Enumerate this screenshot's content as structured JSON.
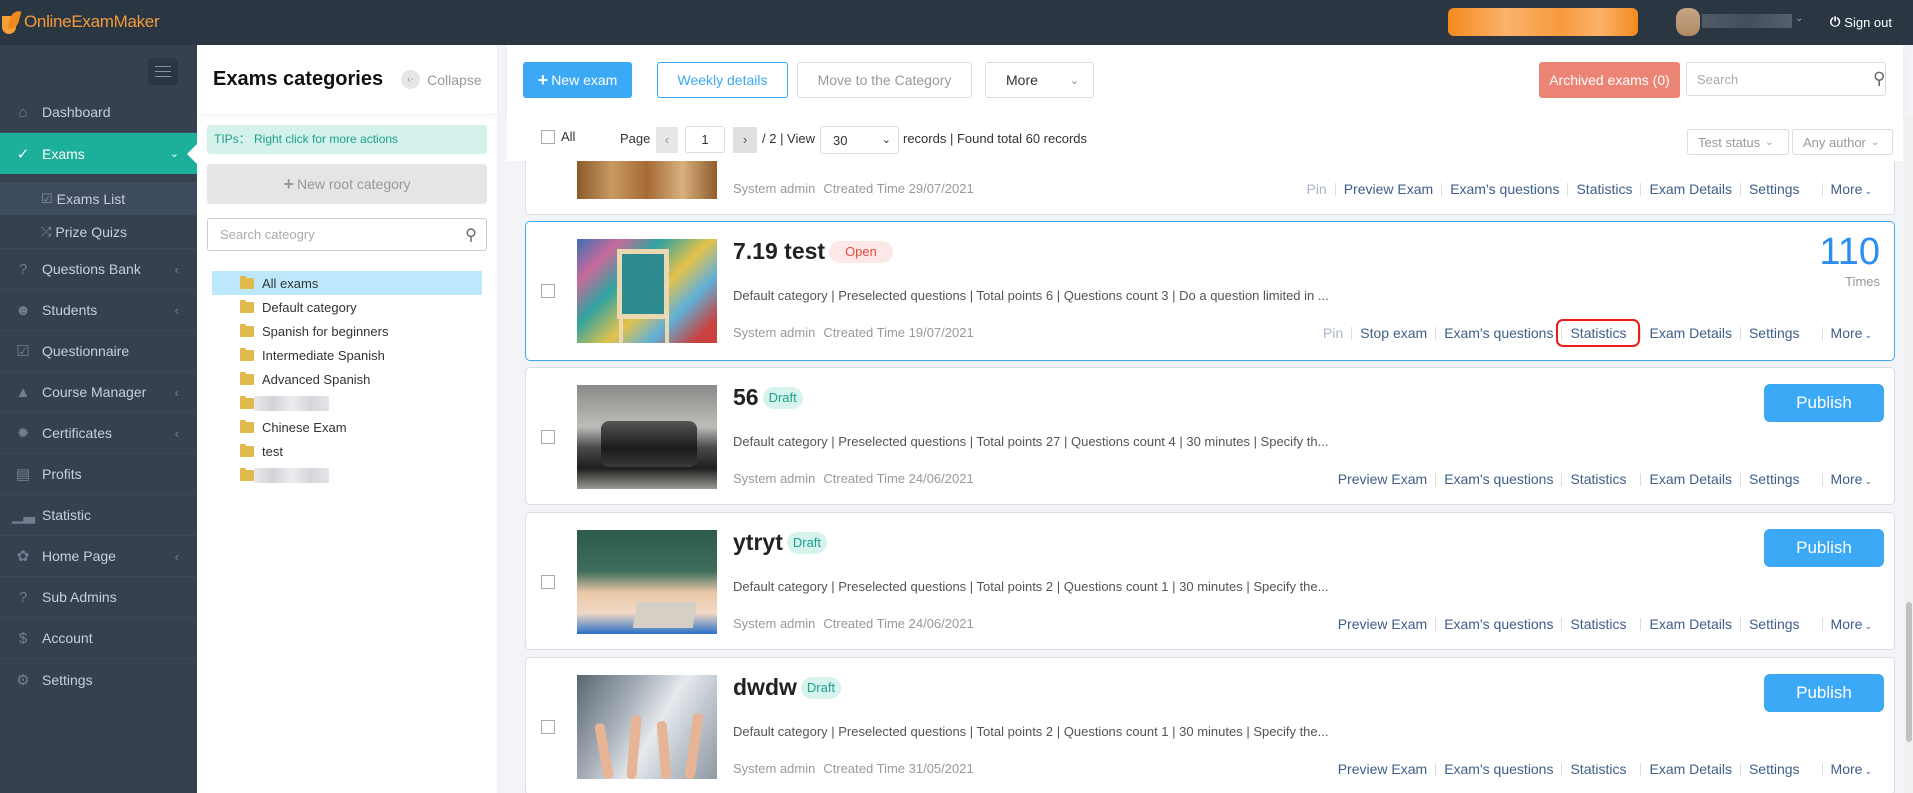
{
  "app": {
    "brand": "OnlineExamMaker",
    "sign_out": "Sign out"
  },
  "sidebar": {
    "items": [
      {
        "label": "Dashboard",
        "icon": "home-icon"
      },
      {
        "label": "Exams",
        "icon": "check-circle-icon",
        "active": true
      },
      {
        "label": "Questions Bank",
        "icon": "question-circle-icon",
        "has_children": true
      },
      {
        "label": "Students",
        "icon": "user-icon",
        "has_children": true
      },
      {
        "label": "Questionnaire",
        "icon": "checkbox-icon"
      },
      {
        "label": "Course Manager",
        "icon": "graduation-cap-icon",
        "has_children": true
      },
      {
        "label": "Certificates",
        "icon": "certificate-icon",
        "has_children": true
      },
      {
        "label": "Profits",
        "icon": "credit-card-icon"
      },
      {
        "label": "Statistic",
        "icon": "bar-chart-icon"
      },
      {
        "label": "Home Page",
        "icon": "leaf-icon",
        "has_children": true
      },
      {
        "label": "Sub Admins",
        "icon": "question-circle-icon"
      },
      {
        "label": "Account",
        "icon": "dollar-icon"
      },
      {
        "label": "Settings",
        "icon": "gear-icon"
      }
    ],
    "exams_sub": [
      {
        "label": "Exams List",
        "icon": "check-circle-icon",
        "active": true
      },
      {
        "label": "Prize Quizs",
        "icon": "shuffle-icon"
      }
    ]
  },
  "categories": {
    "title": "Exams categories",
    "collapse": "Collapse",
    "tips": "TIPs： Right click for more actions",
    "new_root": "New root category",
    "search_placeholder": "Search cateogry",
    "items": [
      {
        "label": "All exams",
        "selected": true
      },
      {
        "label": "Default category"
      },
      {
        "label": "Spanish for beginners"
      },
      {
        "label": "Intermediate Spanish"
      },
      {
        "label": "Advanced Spanish"
      },
      {
        "label": "",
        "blurred": true
      },
      {
        "label": "Chinese Exam"
      },
      {
        "label": "test"
      },
      {
        "label": "",
        "blurred": true
      }
    ]
  },
  "toolbar": {
    "new_exam": "New exam",
    "weekly_details": "Weekly details",
    "move_category": "Move to the Category",
    "more": "More",
    "archived": "Archived exams (0)",
    "search_placeholder": "Search"
  },
  "pager": {
    "all": "All",
    "page_label": "Page",
    "page": "1",
    "total_pages": "/ 2 | View",
    "per_page": "30",
    "records": "records | Found total 60 records",
    "filter_status": "Test status",
    "filter_author": "Any author"
  },
  "exams": [
    {
      "title": "",
      "author": "System admin",
      "created": "Ctreated Time 29/07/2021",
      "actions": [
        "Pin",
        "Preview Exam",
        "Exam's questions",
        "Statistics",
        "Exam Details",
        "Settings",
        "More"
      ]
    },
    {
      "title": "7.19 test",
      "status": "Open",
      "desc": "Default category | Preselected questions | Total points 6 | Questions count 3 | Do a question limited in ...",
      "author": "System admin",
      "created": "Ctreated Time 19/07/2021",
      "count": "110",
      "count_unit": "Times",
      "actions": [
        "Pin",
        "Stop exam",
        "Exam's questions",
        "Statistics",
        "Exam Details",
        "Settings",
        "More"
      ],
      "highlighted_action": "Statistics"
    },
    {
      "title": "56",
      "status": "Draft",
      "desc": "Default category | Preselected questions | Total points 27 | Questions count 4 | 30 minutes | Specify th...",
      "author": "System admin",
      "created": "Ctreated Time 24/06/2021",
      "publish": "Publish",
      "actions": [
        "Preview Exam",
        "Exam's questions",
        "Statistics",
        "Exam Details",
        "Settings",
        "More"
      ]
    },
    {
      "title": "ytryt",
      "status": "Draft",
      "desc": "Default category | Preselected questions | Total points 2 | Questions count 1 | 30 minutes | Specify the...",
      "author": "System admin",
      "created": "Ctreated Time 24/06/2021",
      "publish": "Publish",
      "actions": [
        "Preview Exam",
        "Exam's questions",
        "Statistics",
        "Exam Details",
        "Settings",
        "More"
      ]
    },
    {
      "title": "dwdw",
      "status": "Draft",
      "desc": "Default category | Preselected questions | Total points 2 | Questions count 1 | 30 minutes | Specify the...",
      "author": "System admin",
      "created": "Ctreated Time 31/05/2021",
      "publish": "Publish",
      "actions": [
        "Preview Exam",
        "Exam's questions",
        "Statistics",
        "Exam Details",
        "Settings",
        "More"
      ]
    }
  ],
  "colors": {
    "header_bg": "#2b3643",
    "sidebar_bg": "#364150",
    "active_nav": "#1caf9a",
    "primary": "#3ba9f5",
    "archived": "#eb8474",
    "open_badge": "#e74c3c",
    "draft_badge": "#1ea08b",
    "highlight_box": "#ee1b1b"
  }
}
